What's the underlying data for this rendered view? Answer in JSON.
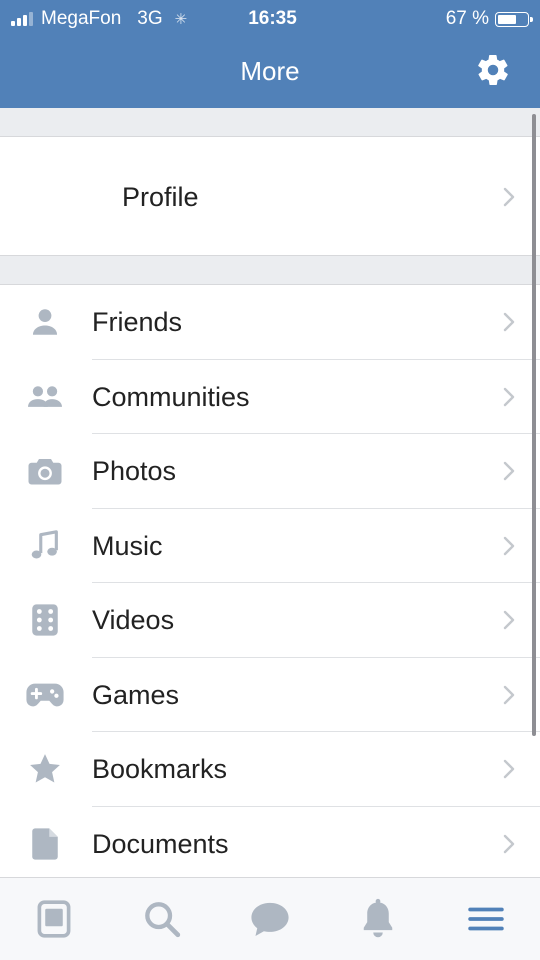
{
  "status_bar": {
    "carrier": "MegaFon",
    "network": "3G",
    "time": "16:35",
    "battery": "67 %",
    "battery_level": 0.67
  },
  "header": {
    "title": "More"
  },
  "profile": {
    "label": "Profile"
  },
  "menu": {
    "items": [
      {
        "label": "Friends",
        "icon": "person-icon"
      },
      {
        "label": "Communities",
        "icon": "people-icon"
      },
      {
        "label": "Photos",
        "icon": "camera-icon"
      },
      {
        "label": "Music",
        "icon": "music-note-icon"
      },
      {
        "label": "Videos",
        "icon": "film-icon"
      },
      {
        "label": "Games",
        "icon": "gamepad-icon"
      },
      {
        "label": "Bookmarks",
        "icon": "star-icon"
      },
      {
        "label": "Documents",
        "icon": "document-icon"
      }
    ]
  },
  "tab_bar": {
    "tabs": [
      "news-icon",
      "search-icon",
      "messages-icon",
      "notifications-icon",
      "menu-icon"
    ],
    "active": "menu-icon"
  },
  "colors": {
    "header_bg": "#5181b8",
    "icon_gray": "#aeb7c2",
    "active_tab": "#5181b8",
    "page_bg": "#ebedf0"
  }
}
